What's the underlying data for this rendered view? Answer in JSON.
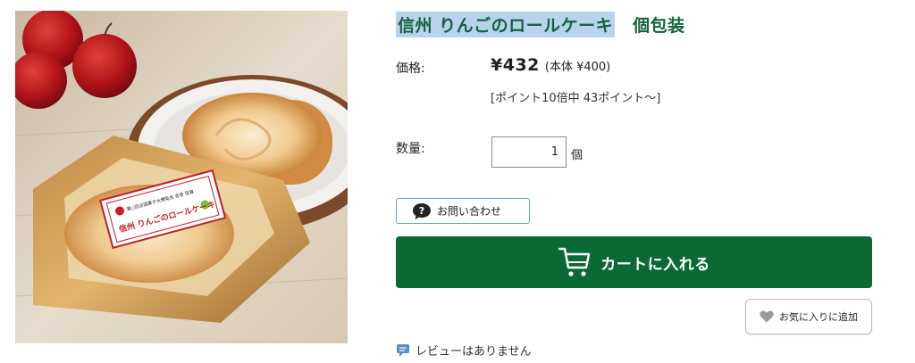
{
  "product": {
    "title_main": "信州 りんごのロールケーキ",
    "title_sub": "個包装",
    "image_alt": "信州 りんごのロールケーキ",
    "package_label": "信州 りんごのロールケーキ",
    "package_small_text": "第○回全国菓子大博覧会 名誉 受賞"
  },
  "price": {
    "label": "価格:",
    "value": "¥432",
    "base": "(本体 ¥400)",
    "points": "[ポイント10倍中 43ポイント〜]"
  },
  "quantity": {
    "label": "数量:",
    "value": "1",
    "unit": "個"
  },
  "buttons": {
    "inquiry": "お問い合わせ",
    "cart": "カートに入れる",
    "favorite": "お気に入りに追加"
  },
  "review": {
    "text": "レビューはありません"
  },
  "icons": {
    "inquiry": "question-bubble-icon",
    "cart": "cart-icon",
    "favorite": "heart-icon",
    "review": "speech-bubble-icon"
  },
  "colors": {
    "brand_green": "#0b6a34",
    "title_green": "#14643a",
    "title_highlight": "#b9d3ee",
    "inquiry_border": "#6ea0c8"
  }
}
